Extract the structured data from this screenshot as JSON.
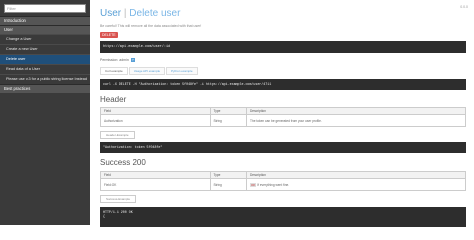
{
  "sidebar": {
    "search_placeholder": "Filter",
    "items": [
      {
        "label": "Introduction",
        "type": "header"
      },
      {
        "label": "User",
        "type": "header"
      },
      {
        "label": "Change a User",
        "type": "item"
      },
      {
        "label": "Create a new User",
        "type": "item"
      },
      {
        "label": "Delete user",
        "type": "active"
      },
      {
        "label": "Read data of a User",
        "type": "item"
      },
      {
        "label": "Please use v.3 for a public string license Instead",
        "type": "item"
      },
      {
        "label": "Best practices",
        "type": "header"
      }
    ]
  },
  "page": {
    "version": "0.0.0",
    "title_a": "User",
    "title_sep": "|",
    "title_b": "Delete user",
    "description": "Be careful! This will remove all the data associated with that user!",
    "method": "DELETE",
    "url": "https://api.example.com/user/:id",
    "permission_label": "Permission: admin",
    "permission_icon": "?",
    "tabs": [
      "Curl example",
      "Usage API example",
      "Python example"
    ],
    "curl": "curl -X DELETE -H \"Authorization: token 5f048fe\" -i https://api.example.com/user/4711",
    "header_section": "Header",
    "header_table": {
      "columns": [
        "Field",
        "Type",
        "Description"
      ],
      "rows": [
        [
          "Authorization",
          "String",
          "The token can be generated from your user profile."
        ]
      ]
    },
    "header_example_btn": "Header-Example",
    "header_example": "\"Authorization: token 5f048fe\"",
    "success_section": "Success 200",
    "success_table": {
      "columns": [
        "Field",
        "Type",
        "Description"
      ],
      "rows": [
        [
          "Field:OK",
          "String",
          "If everything went fine."
        ]
      ]
    },
    "success_tag": "OK",
    "success_example_btn": "Success-Example",
    "success_example_line1": "HTTP/1.1 200 OK",
    "success_example_line2": "{"
  }
}
